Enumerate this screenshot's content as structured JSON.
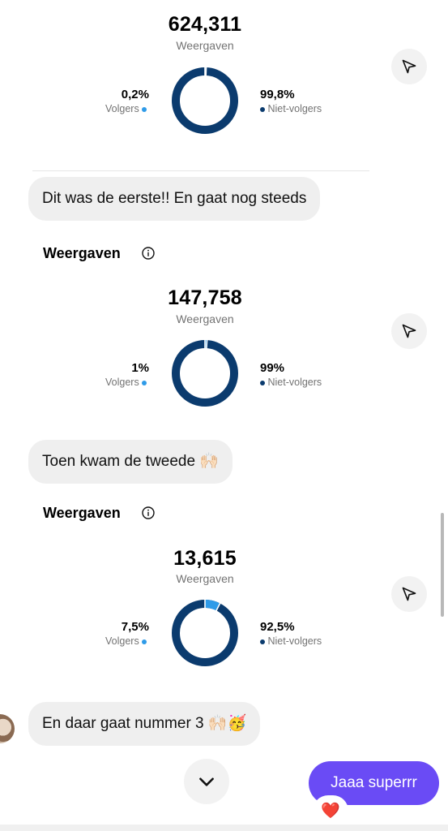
{
  "cards": [
    {
      "total": "624,311",
      "total_label": "Weergaven",
      "followers_pct": "0,2%",
      "followers_label": "Volgers",
      "nonfollowers_pct": "99,8%",
      "nonfollowers_label": "Niet-volgers",
      "followers_fraction": 0.002
    },
    {
      "section_title": "Weergaven",
      "total": "147,758",
      "total_label": "Weergaven",
      "followers_pct": "1%",
      "followers_label": "Volgers",
      "nonfollowers_pct": "99%",
      "nonfollowers_label": "Niet-volgers",
      "followers_fraction": 0.01
    },
    {
      "section_title": "Weergaven",
      "total": "13,615",
      "total_label": "Weergaven",
      "followers_pct": "7,5%",
      "followers_label": "Volgers",
      "nonfollowers_pct": "92,5%",
      "nonfollowers_label": "Niet-volgers",
      "followers_fraction": 0.075
    }
  ],
  "messages": {
    "m1": "Dit was de eerste!! En gaat nog steeds",
    "m2": "Toen kwam de tweede",
    "m2_emoji": "🙌🏻",
    "m3": "En daar gaat nummer 3",
    "m3_emoji": "🙌🏻🥳",
    "sent": "Jaaa superrr",
    "reaction": "❤️"
  },
  "colors": {
    "ring_dark": "#0b3b6e",
    "ring_light": "#2f9be8",
    "sent_bubble": "#6a4bf5",
    "received_bubble": "#efefef"
  },
  "icons": {
    "share": "paper-plane-icon",
    "info": "info-circle-icon",
    "scroll_down": "chevron-down-icon"
  }
}
